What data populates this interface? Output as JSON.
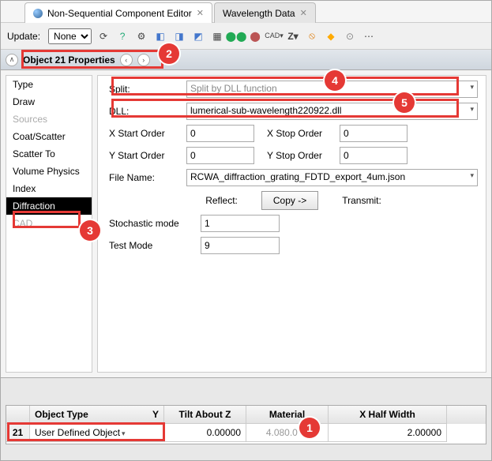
{
  "tabs": {
    "active": "Non-Sequential Component Editor",
    "inactive": "Wavelength Data"
  },
  "toolbar": {
    "update_label": "Update:",
    "update_value": "None"
  },
  "props": {
    "title": "Object  21 Properties"
  },
  "side": {
    "items": [
      "Type",
      "Draw",
      "Sources",
      "Coat/Scatter",
      "Scatter To",
      "Volume Physics",
      "Index",
      "Diffraction",
      "CAD"
    ]
  },
  "panel": {
    "split_label": "Split:",
    "split_value": "Split by DLL function",
    "dll_label": "DLL:",
    "dll_value": "lumerical-sub-wavelength220922.dll",
    "xso_label": "X Start Order",
    "xso_value": "0",
    "xeo_label": "X Stop Order",
    "xeo_value": "0",
    "yso_label": "Y Start Order",
    "yso_value": "0",
    "yeo_label": "Y Stop Order",
    "yeo_value": "0",
    "file_label": "File Name:",
    "file_value": "RCWA_diffraction_grating_FDTD_export_4um.json",
    "reflect": "Reflect:",
    "copy": "Copy ->",
    "transmit": "Transmit:",
    "stoch_label": "Stochastic mode",
    "stoch_value": "1",
    "test_label": "Test Mode",
    "test_value": "9"
  },
  "grid": {
    "headers": [
      "",
      "Object Type",
      "Tilt About Z",
      "Material",
      "X Half Width"
    ],
    "head_suffix": "Y",
    "row": {
      "num": "21",
      "type": "User Defined Object",
      "tilt": "0.00000",
      "mat": "4.080.0   M",
      "xhw": "2.00000"
    }
  }
}
